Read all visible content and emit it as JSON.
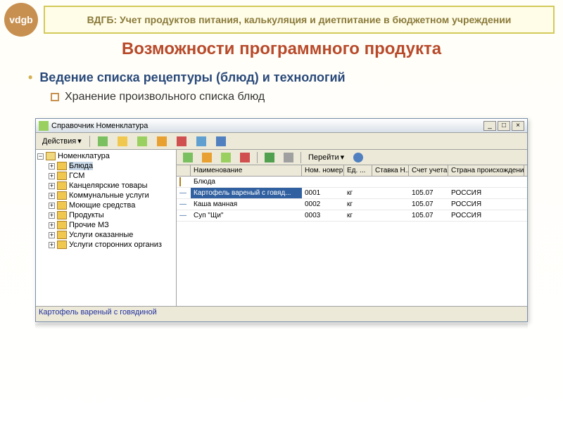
{
  "slide": {
    "header": "ВДГБ: Учет продуктов питания, калькуляция и диетпитание в бюджетном учреждении",
    "title": "Возможности программного продукта",
    "bullet1": "Ведение списка рецептуры (блюд) и технологий",
    "bullet2": "Хранение произвольного списка блюд",
    "logo": "vdgb"
  },
  "window": {
    "title": "Справочник Номенклатура",
    "actions_label": "Действия",
    "goto_label": "Перейти",
    "tree": {
      "root": "Номенклатура",
      "items": [
        "Блюда",
        "ГСМ",
        "Канцелярские товары",
        "Коммунальные услуги",
        "Моющие средства",
        "Продукты",
        "Прочие МЗ",
        "Услуги оказанные",
        "Услуги сторонних организ"
      ]
    },
    "columns": {
      "c0": "",
      "c1": "Наименование",
      "c2": "Ном. номер",
      "c3": "Ед. ...",
      "c4": "Ставка Н...",
      "c5": "Счет учета",
      "c6": "Страна происхождения"
    },
    "group_row": "Блюда",
    "rows": [
      {
        "name": "Картофель вареный с говяд...",
        "num": "0001",
        "unit": "кг",
        "vat": "",
        "acct": "105.07",
        "country": "РОССИЯ"
      },
      {
        "name": "Каша манная",
        "num": "0002",
        "unit": "кг",
        "vat": "",
        "acct": "105.07",
        "country": "РОССИЯ"
      },
      {
        "name": "Суп \"Щи\"",
        "num": "0003",
        "unit": "кг",
        "vat": "",
        "acct": "105.07",
        "country": "РОССИЯ"
      }
    ],
    "status": "Картофель вареный с говядиной"
  },
  "colwidths": {
    "c0": 20,
    "c1": 158,
    "c2": 60,
    "c3": 40,
    "c4": 52,
    "c5": 56,
    "c6": 108
  }
}
